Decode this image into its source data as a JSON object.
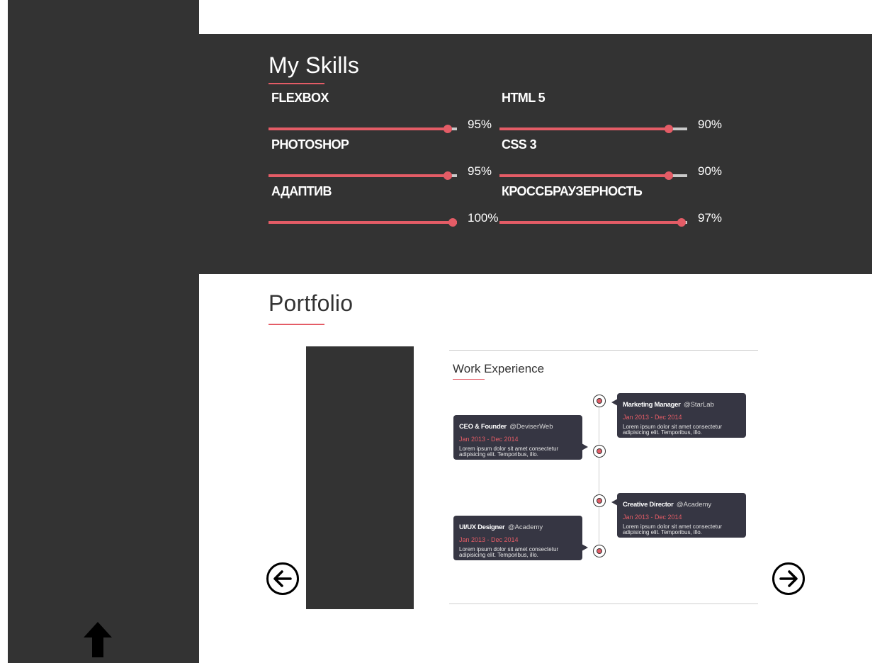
{
  "skills": {
    "title": "My Skills",
    "items": [
      {
        "name": "FLEXBOX",
        "percent_label": "95%",
        "value": 95
      },
      {
        "name": "HTML 5",
        "percent_label": "90%",
        "value": 90
      },
      {
        "name": "PHOTOSHOP",
        "percent_label": "95%",
        "value": 95
      },
      {
        "name": "CSS 3",
        "percent_label": "90%",
        "value": 90
      },
      {
        "name": "АДАПТИВ",
        "percent_label": "100%",
        "value": 100
      },
      {
        "name": "КРОССБРАУЗЕРНОСТЬ",
        "percent_label": "97%",
        "value": 97
      }
    ]
  },
  "portfolio": {
    "title": "Portfolio",
    "card": {
      "title": "Work Experience",
      "jobs": [
        {
          "role": "Marketing Manager",
          "company": "@StarLab",
          "dates": "Jan 2013 - Dec 2014",
          "desc": "Lorem ipsum dolor sit amet consectetur adipisicing elit. Temporibus, illo."
        },
        {
          "role": "CEO & Founder",
          "company": "@DeviserWeb",
          "dates": "Jan 2013 - Dec 2014",
          "desc": "Lorem ipsum dolor sit amet consectetur adipisicing elit. Temporibus, illo."
        },
        {
          "role": "Creative Director",
          "company": "@Academy",
          "dates": "Jan 2013 - Dec 2014",
          "desc": "Lorem ipsum dolor sit amet consectetur adipisicing elit. Temporibus, illo."
        },
        {
          "role": "UI/UX Designer",
          "company": "@Academy",
          "dates": "Jan 2013 - Dec 2014",
          "desc": "Lorem ipsum dolor sit amet consectetur adipisicing elit. Temporibus, illo."
        }
      ]
    }
  },
  "icons": {
    "prev": "arrow-left-circle-icon",
    "next": "arrow-right-circle-icon",
    "scroll_top": "arrow-up-icon"
  },
  "colors": {
    "accent": "#e45c66",
    "dark": "#333333",
    "track": "#c9c9c9",
    "job_card": "#363643"
  }
}
